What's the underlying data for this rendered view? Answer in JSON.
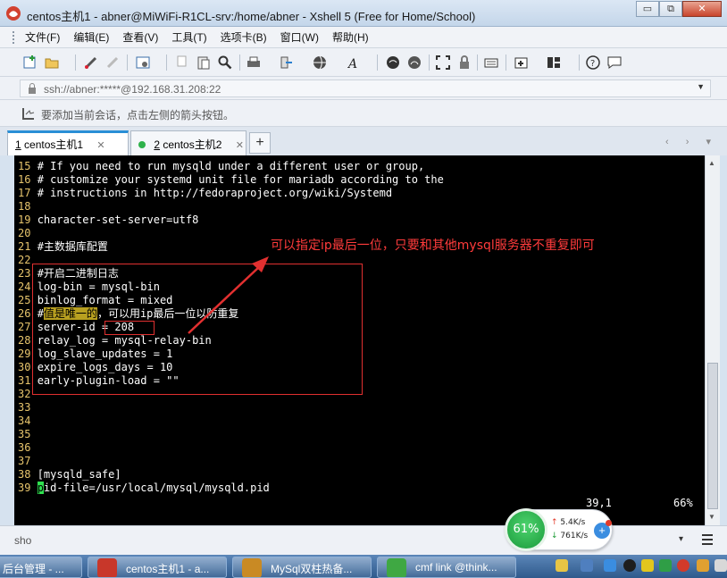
{
  "window": {
    "title": "centos主机1 - abner@MiWiFi-R1CL-srv:/home/abner - Xshell 5 (Free for Home/School)",
    "controls": {
      "minimize": "▭",
      "maximize": "⧉",
      "close": "✕"
    }
  },
  "menu": {
    "items": [
      "文件(F)",
      "编辑(E)",
      "查看(V)",
      "工具(T)",
      "选项卡(B)",
      "窗口(W)",
      "帮助(H)"
    ]
  },
  "address": {
    "value": "ssh://abner:*****@192.168.31.208:22"
  },
  "hint": {
    "text": "要添加当前会话，点击左侧的箭头按钮。"
  },
  "tabs": [
    {
      "num": "1",
      "label": "centos主机1",
      "close": "✕",
      "active": true
    },
    {
      "num": "2",
      "label": "centos主机2",
      "close": "✕",
      "active": false
    }
  ],
  "tab_add": "+",
  "tab_nav": "‹ › ▾",
  "terminal": {
    "lines": [
      {
        "n": "15",
        "t": "# If you need to run mysqld under a different user or group,"
      },
      {
        "n": "16",
        "t": "# customize your systemd unit file for mariadb according to the"
      },
      {
        "n": "17",
        "t": "# instructions in http://fedoraproject.org/wiki/Systemd"
      },
      {
        "n": "18",
        "t": ""
      },
      {
        "n": "19",
        "t": "character-set-server=utf8"
      },
      {
        "n": "20",
        "t": ""
      },
      {
        "n": "21",
        "t": "#主数据库配置"
      },
      {
        "n": "22",
        "t": ""
      },
      {
        "n": "23",
        "t": "#开启二进制日志"
      },
      {
        "n": "24",
        "t": "log-bin = mysql-bin"
      },
      {
        "n": "25",
        "t": "binlog_format = mixed"
      },
      {
        "n": "26",
        "t_pre": "#",
        "t_hl": "值是唯一的",
        "t_post": "，可以用ip最后一位以防重复"
      },
      {
        "n": "27",
        "t": "server-id = 208"
      },
      {
        "n": "28",
        "t": "relay_log = mysql-relay-bin"
      },
      {
        "n": "29",
        "t": "log_slave_updates = 1"
      },
      {
        "n": "30",
        "t": "expire_logs_days = 10"
      },
      {
        "n": "31",
        "t": "early-plugin-load = \"\""
      },
      {
        "n": "32",
        "t": ""
      },
      {
        "n": "33",
        "t": ""
      },
      {
        "n": "34",
        "t": ""
      },
      {
        "n": "35",
        "t": ""
      },
      {
        "n": "36",
        "t": ""
      },
      {
        "n": "37",
        "t": ""
      },
      {
        "n": "38",
        "t": "[mysqld_safe]"
      },
      {
        "n": "39",
        "t_cursor": "p",
        "t_post": "id-file=/usr/local/mysql/mysqld.pid"
      }
    ],
    "position": "39,1",
    "percent": "66%",
    "annotation": "可以指定ip最后一位，只要和其他mysql服务器不重复即可"
  },
  "inputbar": {
    "text": "sho",
    "dropdown": "▾"
  },
  "network": {
    "percent": "61%",
    "up_arrow": "↑",
    "up": "5.4K/s",
    "down_arrow": "↓",
    "down": "761K/s",
    "plus": "+"
  },
  "taskbar": {
    "items": [
      {
        "label": "后台管理 - ...",
        "color": "#2b63b0"
      },
      {
        "label": "centos主机1 - a...",
        "color": "#c8372a"
      },
      {
        "label": "MySql双柱热备...",
        "color": "#c98a24"
      },
      {
        "label": "cmf link @think...",
        "color": "#3fa843"
      }
    ]
  }
}
